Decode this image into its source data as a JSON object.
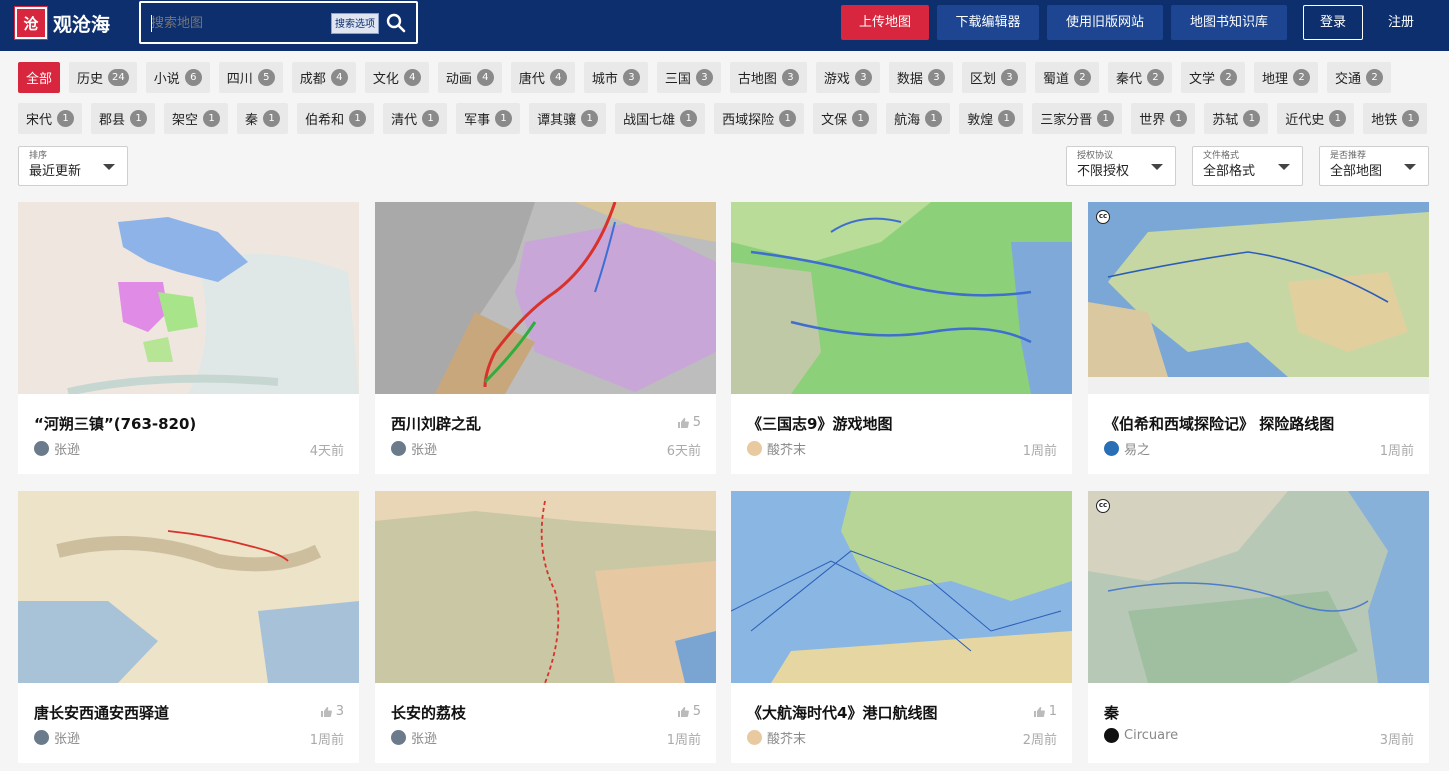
{
  "header": {
    "logo_mark": "沧",
    "logo_text": "观沧海",
    "search_placeholder": "搜索地图",
    "search_options_label": "搜索选项",
    "buttons": {
      "upload": "上传地图",
      "download_editor": "下载编辑器",
      "old_site": "使用旧版网站",
      "knowledge": "地图书知识库",
      "login": "登录",
      "register": "注册"
    }
  },
  "tags": {
    "row1": [
      {
        "label": "全部",
        "count": ""
      },
      {
        "label": "历史",
        "count": "24"
      },
      {
        "label": "小说",
        "count": "6"
      },
      {
        "label": "四川",
        "count": "5"
      },
      {
        "label": "成都",
        "count": "4"
      },
      {
        "label": "文化",
        "count": "4"
      },
      {
        "label": "动画",
        "count": "4"
      },
      {
        "label": "唐代",
        "count": "4"
      },
      {
        "label": "城市",
        "count": "3"
      },
      {
        "label": "三国",
        "count": "3"
      },
      {
        "label": "古地图",
        "count": "3"
      },
      {
        "label": "游戏",
        "count": "3"
      },
      {
        "label": "数据",
        "count": "3"
      },
      {
        "label": "区划",
        "count": "3"
      },
      {
        "label": "蜀道",
        "count": "2"
      },
      {
        "label": "秦代",
        "count": "2"
      },
      {
        "label": "文学",
        "count": "2"
      },
      {
        "label": "地理",
        "count": "2"
      },
      {
        "label": "交通",
        "count": "2"
      }
    ],
    "row2": [
      {
        "label": "宋代",
        "count": "1"
      },
      {
        "label": "郡县",
        "count": "1"
      },
      {
        "label": "架空",
        "count": "1"
      },
      {
        "label": "秦",
        "count": "1"
      },
      {
        "label": "伯希和",
        "count": "1"
      },
      {
        "label": "清代",
        "count": "1"
      },
      {
        "label": "军事",
        "count": "1"
      },
      {
        "label": "谭其骧",
        "count": "1"
      },
      {
        "label": "战国七雄",
        "count": "1"
      },
      {
        "label": "西域探险",
        "count": "1"
      },
      {
        "label": "文保",
        "count": "1"
      },
      {
        "label": "航海",
        "count": "1"
      },
      {
        "label": "敦煌",
        "count": "1"
      },
      {
        "label": "三家分晋",
        "count": "1"
      },
      {
        "label": "世界",
        "count": "1"
      },
      {
        "label": "苏轼",
        "count": "1"
      },
      {
        "label": "近代史",
        "count": "1"
      },
      {
        "label": "地铁",
        "count": "1"
      }
    ]
  },
  "filters": {
    "sort": {
      "label": "排序",
      "value": "最近更新"
    },
    "license": {
      "label": "授权协议",
      "value": "不限授权"
    },
    "format": {
      "label": "文件格式",
      "value": "全部格式"
    },
    "recommended": {
      "label": "是否推荐",
      "value": "全部地图"
    }
  },
  "cards": [
    {
      "title": "“河朔三镇”(763-820)",
      "author": "张逊",
      "time": "4天前",
      "likes": "",
      "avatar_color": "#6b7b8c"
    },
    {
      "title": "西川刘辟之乱",
      "author": "张逊",
      "time": "6天前",
      "likes": "5",
      "avatar_color": "#6b7b8c"
    },
    {
      "title": "《三国志9》游戏地图",
      "author": "酸芥末",
      "time": "1周前",
      "likes": "",
      "avatar_color": "#e8c9a0"
    },
    {
      "title": "《伯希和西域探险记》 探险路线图",
      "author": "易之",
      "time": "1周前",
      "likes": "",
      "avatar_color": "#2a6fb5"
    },
    {
      "title": "唐长安西通安西驿道",
      "author": "张逊",
      "time": "1周前",
      "likes": "3",
      "avatar_color": "#6b7b8c"
    },
    {
      "title": "长安的荔枝",
      "author": "张逊",
      "time": "1周前",
      "likes": "5",
      "avatar_color": "#6b7b8c"
    },
    {
      "title": "《大航海时代4》港口航线图",
      "author": "酸芥末",
      "time": "2周前",
      "likes": "1",
      "avatar_color": "#e8c9a0"
    },
    {
      "title": "秦",
      "author": "Circuare",
      "time": "3周前",
      "likes": "",
      "avatar_color": "#111111"
    }
  ],
  "icons": {
    "search": "search-icon",
    "thumb_up": "thumb-up-icon",
    "caret": "caret-down-icon",
    "cc": "creative-commons-icon"
  },
  "colors": {
    "header_bg": "#0d2f6e",
    "accent_red": "#d7263d",
    "button_blue": "#1d4591"
  }
}
